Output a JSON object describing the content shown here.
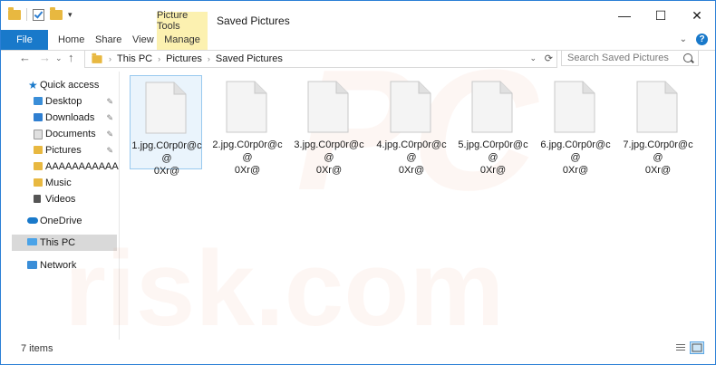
{
  "titlebar": {
    "title": "Saved Pictures",
    "context_tab_top": "Picture Tools",
    "window_buttons": {
      "minimize": "—",
      "maximize": "☐",
      "close": "✕"
    }
  },
  "ribbon": {
    "tabs": [
      {
        "label": "File"
      },
      {
        "label": "Home"
      },
      {
        "label": "Share"
      },
      {
        "label": "View"
      },
      {
        "label": "Manage"
      }
    ],
    "help": "?"
  },
  "address": {
    "crumbs": [
      "This PC",
      "Pictures",
      "Saved Pictures"
    ],
    "search_placeholder": "Search Saved Pictures"
  },
  "sidebar": {
    "items": [
      {
        "label": "Quick access",
        "icon": "star-icon"
      },
      {
        "label": "Desktop",
        "icon": "desktop-icon",
        "pinned": true
      },
      {
        "label": "Downloads",
        "icon": "downloads-icon",
        "pinned": true
      },
      {
        "label": "Documents",
        "icon": "documents-icon",
        "pinned": true
      },
      {
        "label": "Pictures",
        "icon": "pictures-icon",
        "pinned": true
      },
      {
        "label": "AAAAAAAAAAAAA",
        "icon": "folder-icon"
      },
      {
        "label": "Music",
        "icon": "music-icon"
      },
      {
        "label": "Videos",
        "icon": "videos-icon"
      },
      {
        "label": "OneDrive",
        "icon": "cloud-icon"
      },
      {
        "label": "This PC",
        "icon": "computer-icon",
        "selected": true
      },
      {
        "label": "Network",
        "icon": "network-icon"
      }
    ]
  },
  "files": [
    {
      "line1": "1.jpg.C0rp0r@c@",
      "line2": "0Xr@",
      "selected": true
    },
    {
      "line1": "2.jpg.C0rp0r@c@",
      "line2": "0Xr@"
    },
    {
      "line1": "3.jpg.C0rp0r@c@",
      "line2": "0Xr@"
    },
    {
      "line1": "4.jpg.C0rp0r@c@",
      "line2": "0Xr@"
    },
    {
      "line1": "5.jpg.C0rp0r@c@",
      "line2": "0Xr@"
    },
    {
      "line1": "6.jpg.C0rp0r@c@",
      "line2": "0Xr@"
    },
    {
      "line1": "7.jpg.C0rp0r@c@",
      "line2": "0Xr@"
    }
  ],
  "status": {
    "count_text": "7 items"
  },
  "watermark": {
    "logo": "PC",
    "text": "risk.com"
  },
  "colors": {
    "accent": "#1979ca",
    "context": "#fcf1b0",
    "selection": "#eaf4fc"
  }
}
